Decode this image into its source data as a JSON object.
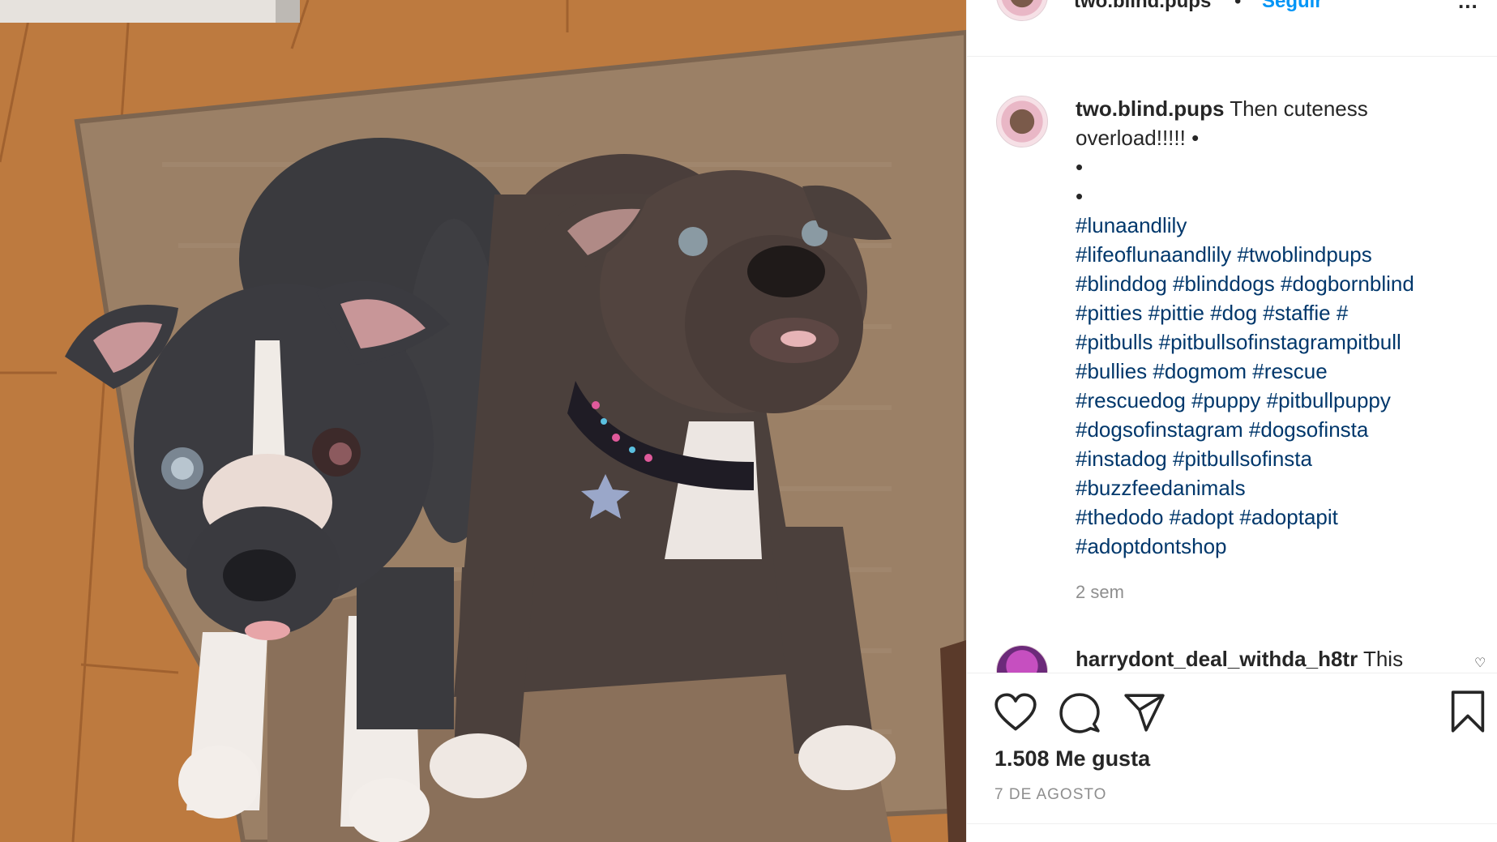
{
  "post": {
    "username": "two.blind.pups",
    "follow_label": "Seguir",
    "header_separator": "•",
    "more_label": "...",
    "caption_lines": [
      "Then cuteness",
      "overload!!!!! •",
      "•",
      "•"
    ],
    "hashtag_lines": [
      "#lunaandlily",
      "#lifeoflunaandlily #twoblindpups",
      "#blinddog #blinddogs #dogbornblind",
      "#pitties #pittie #dog #staffie #",
      "#pitbulls #pitbullsofinstagrampitbull",
      "#bullies #dogmom #rescue",
      "#rescuedog #puppy #pitbullpuppy",
      "#dogsofinstagram #dogsofinsta",
      "#instadog #pitbullsofinsta",
      "#buzzfeedanimals",
      "#thedodo #adopt #adoptapit",
      "#adoptdontshop"
    ],
    "time_ago": "2 sem",
    "likes_label": "1.508 Me gusta",
    "date_label": "7 DE AGOSTO"
  },
  "second_comment": {
    "username": "harrydont_deal_withda_h8tr",
    "text": "This"
  },
  "icons": {
    "like": "heart-icon",
    "comment": "speech-bubble-icon",
    "share": "paper-plane-icon",
    "save": "bookmark-icon",
    "comment_like": "small-heart-icon"
  },
  "colors": {
    "link": "#0095f6",
    "hashtag": "#00376b",
    "text": "#262626",
    "muted": "#8e8e8e"
  }
}
